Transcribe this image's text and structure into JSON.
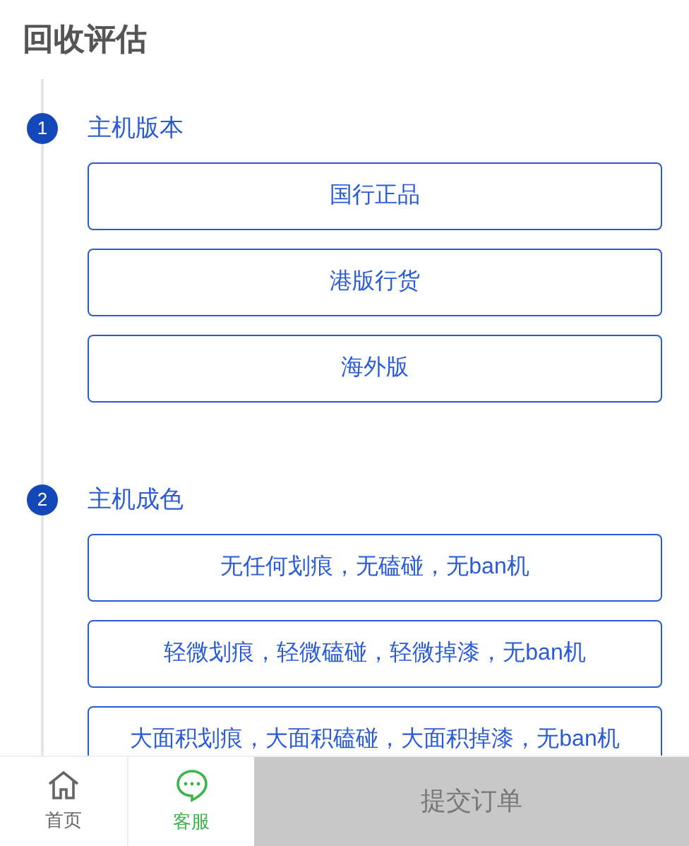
{
  "title": "回收评估",
  "steps": [
    {
      "number": "1",
      "title": "主机版本",
      "options": [
        {
          "label": "国行正品",
          "selected": false
        },
        {
          "label": "港版行货",
          "selected": false
        },
        {
          "label": "海外版",
          "selected": false
        }
      ]
    },
    {
      "number": "2",
      "title": "主机成色",
      "options": [
        {
          "label": "无任何划痕，无磕碰，无ban机",
          "selected": false
        },
        {
          "label": "轻微划痕，轻微磕碰，轻微掉漆，无ban机",
          "selected": false
        },
        {
          "label": "大面积划痕，大面积磕碰，大面积掉漆，无ban机",
          "selected": false
        }
      ]
    }
  ],
  "bottom_bar": {
    "nav": [
      {
        "kind": "home",
        "label": "首页",
        "selected": false
      },
      {
        "kind": "chat",
        "label": "客服",
        "selected": true
      }
    ],
    "submit": {
      "label": "提交订单",
      "disabled": true
    }
  }
}
